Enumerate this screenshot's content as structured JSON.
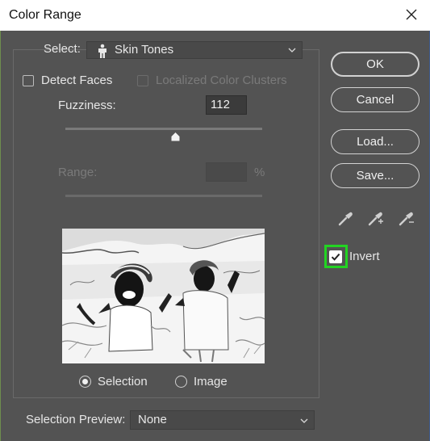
{
  "window": {
    "title": "Color Range"
  },
  "select": {
    "label": "Select:",
    "value": "Skin Tones"
  },
  "detect_faces": {
    "label": "Detect Faces",
    "checked": false
  },
  "localized_clusters": {
    "label": "Localized Color Clusters",
    "checked": false,
    "enabled": false
  },
  "fuzziness": {
    "label": "Fuzziness:",
    "value": "112"
  },
  "range": {
    "label": "Range:",
    "value": "",
    "unit": "%",
    "enabled": false
  },
  "view": {
    "options": [
      {
        "label": "Selection",
        "selected": true
      },
      {
        "label": "Image",
        "selected": false
      }
    ]
  },
  "selection_preview": {
    "label": "Selection Preview:",
    "value": "None"
  },
  "buttons": {
    "ok": "OK",
    "cancel": "Cancel",
    "load": "Load...",
    "save": "Save..."
  },
  "invert": {
    "label": "Invert",
    "checked": true
  },
  "colors": {
    "background": "#535353",
    "highlight": "#22d422"
  }
}
